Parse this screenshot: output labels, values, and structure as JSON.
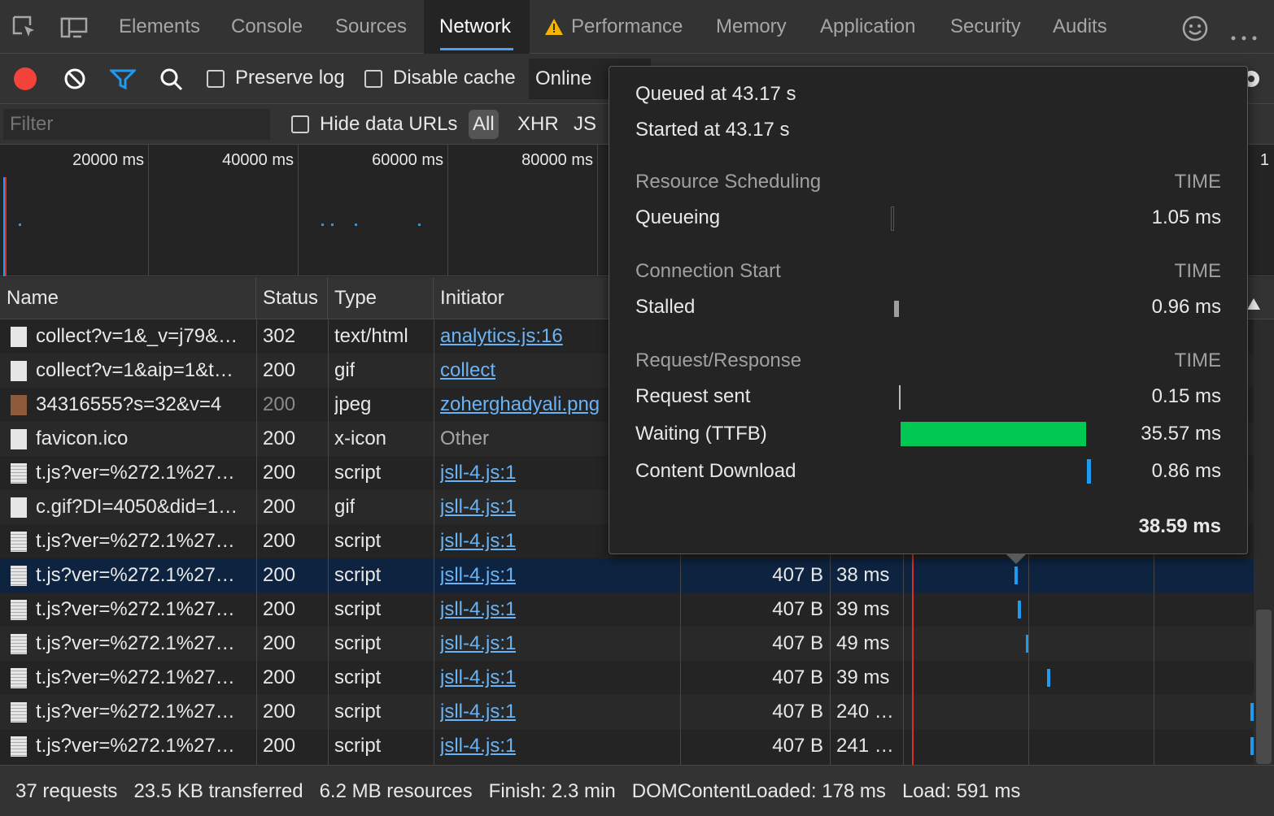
{
  "tabs": [
    {
      "label": "Elements",
      "active": false
    },
    {
      "label": "Console",
      "active": false
    },
    {
      "label": "Sources",
      "active": false
    },
    {
      "label": "Network",
      "active": true
    },
    {
      "label": "Performance",
      "active": false
    },
    {
      "label": "Memory",
      "active": false
    },
    {
      "label": "Application",
      "active": false
    },
    {
      "label": "Security",
      "active": false
    },
    {
      "label": "Audits",
      "active": false
    }
  ],
  "toolbar": {
    "preserve_log": "Preserve log",
    "disable_cache": "Disable cache",
    "throttle": "Online"
  },
  "filterbar": {
    "placeholder": "Filter",
    "hide_data_urls": "Hide data URLs",
    "types": [
      "All",
      "XHR",
      "JS"
    ]
  },
  "overview": {
    "ticks": [
      "20000 ms",
      "40000 ms",
      "60000 ms",
      "80000 ms",
      "1"
    ]
  },
  "columns": {
    "name": "Name",
    "status": "Status",
    "type": "Type",
    "initiator": "Initiator"
  },
  "rows": [
    {
      "name": "collect?v=1&_v=j79&…",
      "status": "302",
      "type": "text/html",
      "initiator": "analytics.js:16",
      "initiator_link": true,
      "size": "",
      "time": ""
    },
    {
      "name": "collect?v=1&aip=1&t…",
      "status": "200",
      "type": "gif",
      "initiator": "collect",
      "initiator_link": true,
      "size": "",
      "time": ""
    },
    {
      "name": "34316555?s=32&v=4",
      "status": "200",
      "type": "jpeg",
      "initiator": "zoherghadyali.png",
      "initiator_link": true,
      "size": "",
      "time": "",
      "dim_status": true
    },
    {
      "name": "favicon.ico",
      "status": "200",
      "type": "x-icon",
      "initiator": "Other",
      "initiator_link": false,
      "size": "",
      "time": ""
    },
    {
      "name": "t.js?ver=%272.1%27…",
      "status": "200",
      "type": "script",
      "initiator": "jsll-4.js:1",
      "initiator_link": true,
      "size": "",
      "time": ""
    },
    {
      "name": "c.gif?DI=4050&did=1…",
      "status": "200",
      "type": "gif",
      "initiator": "jsll-4.js:1",
      "initiator_link": true,
      "size": "",
      "time": ""
    },
    {
      "name": "t.js?ver=%272.1%27…",
      "status": "200",
      "type": "script",
      "initiator": "jsll-4.js:1",
      "initiator_link": true,
      "size": "",
      "time": ""
    },
    {
      "name": "t.js?ver=%272.1%27…",
      "status": "200",
      "type": "script",
      "initiator": "jsll-4.js:1",
      "initiator_link": true,
      "size": "407 B",
      "time": "38 ms",
      "selected": true
    },
    {
      "name": "t.js?ver=%272.1%27…",
      "status": "200",
      "type": "script",
      "initiator": "jsll-4.js:1",
      "initiator_link": true,
      "size": "407 B",
      "time": "39 ms"
    },
    {
      "name": "t.js?ver=%272.1%27…",
      "status": "200",
      "type": "script",
      "initiator": "jsll-4.js:1",
      "initiator_link": true,
      "size": "407 B",
      "time": "49 ms"
    },
    {
      "name": "t.js?ver=%272.1%27…",
      "status": "200",
      "type": "script",
      "initiator": "jsll-4.js:1",
      "initiator_link": true,
      "size": "407 B",
      "time": "39 ms"
    },
    {
      "name": "t.js?ver=%272.1%27…",
      "status": "200",
      "type": "script",
      "initiator": "jsll-4.js:1",
      "initiator_link": true,
      "size": "407 B",
      "time": "240 …"
    },
    {
      "name": "t.js?ver=%272.1%27…",
      "status": "200",
      "type": "script",
      "initiator": "jsll-4.js:1",
      "initiator_link": true,
      "size": "407 B",
      "time": "241 …"
    }
  ],
  "popup": {
    "queued": "Queued at 43.17 s",
    "started": "Started at 43.17 s",
    "time_header": "TIME",
    "sections": [
      {
        "title": "Resource Scheduling",
        "items": [
          {
            "label": "Queueing",
            "value": "1.05 ms"
          }
        ]
      },
      {
        "title": "Connection Start",
        "items": [
          {
            "label": "Stalled",
            "value": "0.96 ms"
          }
        ]
      },
      {
        "title": "Request/Response",
        "items": [
          {
            "label": "Request sent",
            "value": "0.15 ms"
          },
          {
            "label": "Waiting (TTFB)",
            "value": "35.57 ms"
          },
          {
            "label": "Content Download",
            "value": "0.86 ms"
          }
        ]
      }
    ],
    "total": "38.59 ms",
    "colors": {
      "ttfb": "#00c853",
      "download": "#1e9bf0"
    }
  },
  "status": {
    "requests": "37 requests",
    "transferred": "23.5 KB transferred",
    "resources": "6.2 MB resources",
    "finish": "Finish: 2.3 min",
    "dcl": "DOMContentLoaded: 178 ms",
    "load": "Load: 591 ms"
  }
}
